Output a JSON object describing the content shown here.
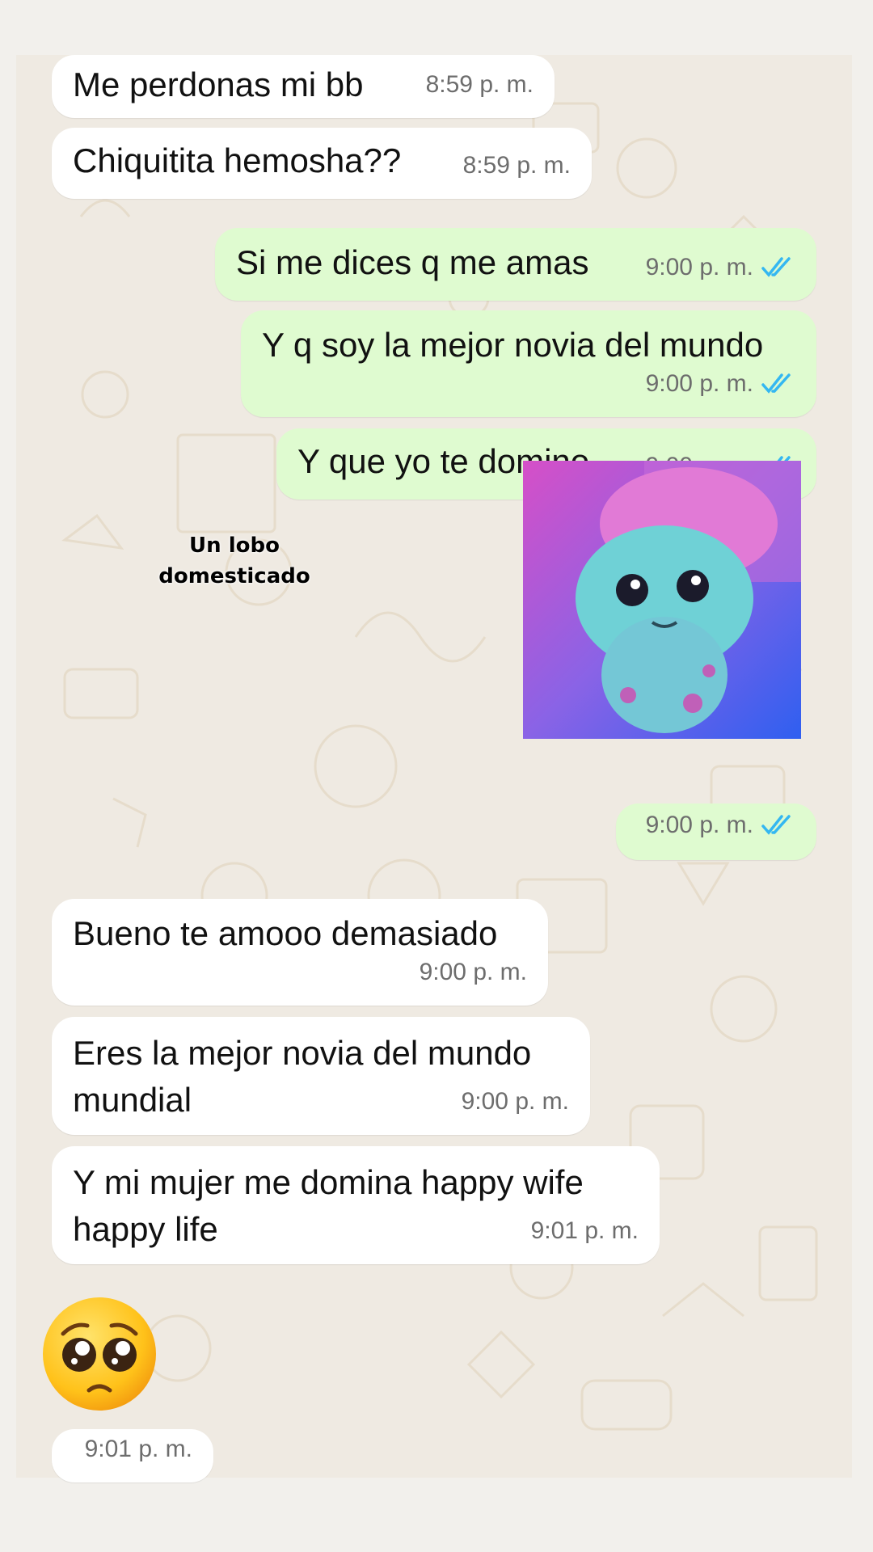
{
  "messages": [
    {
      "text": "Me perdonas mi bb",
      "time": "8:59 p. m."
    },
    {
      "text": "Chiquitita hemosha??",
      "time": "8:59 p. m."
    },
    {
      "text": "Si me dices q me amas",
      "time": "9:00 p. m."
    },
    {
      "text": "Y q soy la mejor novia del mundo",
      "time": "9:00 p. m."
    },
    {
      "text": "Y que yo te domino",
      "time": "9:00 p. m."
    },
    {
      "caption_line1": "Un lobo",
      "caption_line2": "domesticado",
      "time": "9:00 p. m."
    },
    {
      "text": "Bueno te amooo demasiado",
      "time": "9:00 p. m."
    },
    {
      "line1": "Eres la mejor novia del mundo",
      "line2": "mundial",
      "time": "9:00 p. m."
    },
    {
      "line1": "Y mi mujer me domina happy  wife",
      "line2": "happy life",
      "time": "9:01 p. m."
    },
    {
      "emoji": "pleading-face",
      "time": "9:01 p. m."
    }
  ],
  "colors": {
    "incoming_bubble": "#ffffff",
    "outgoing_bubble": "#dffbd0",
    "read_ticks": "#34b7f1",
    "wallpaper": "#efeae2"
  }
}
